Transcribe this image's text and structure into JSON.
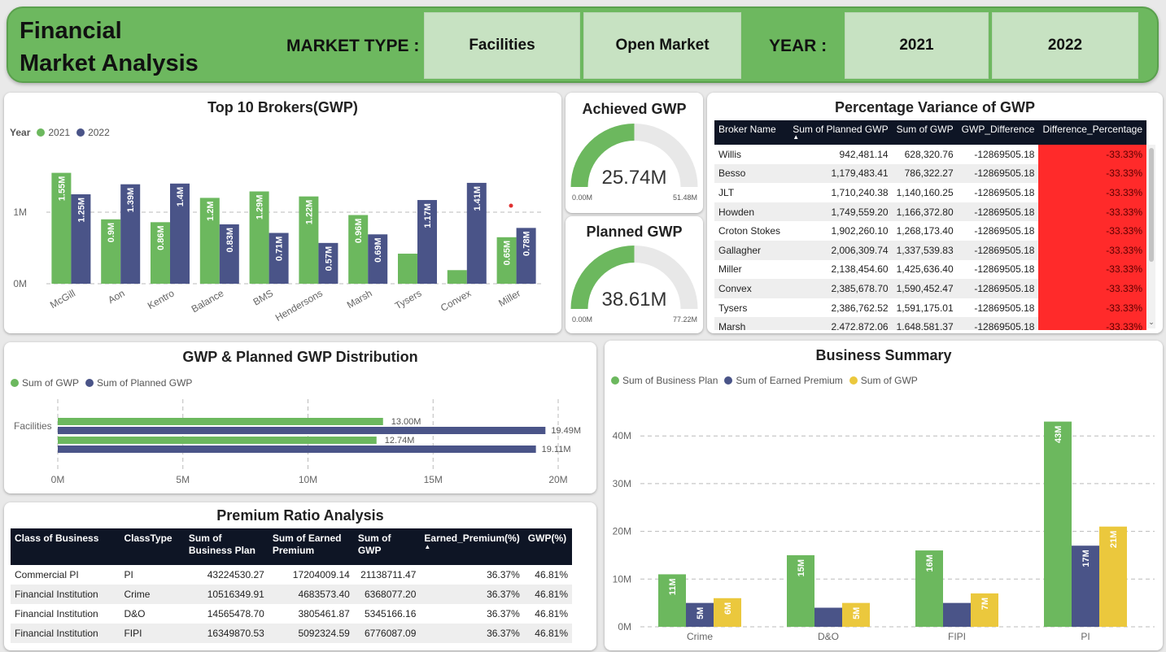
{
  "header": {
    "title_line1": "Financial",
    "title_line2": "Market Analysis",
    "market_type_label": "MARKET TYPE :",
    "market_types": [
      "Facilities",
      "Open Market"
    ],
    "year_label": "YEAR :",
    "years": [
      "2021",
      "2022"
    ]
  },
  "brokers_chart": {
    "title": "Top 10 Brokers(GWP)",
    "legend_title": "Year",
    "chart_data": {
      "type": "bar",
      "categories": [
        "McGill",
        "Aon",
        "Kentro",
        "Balance",
        "BMS",
        "Hendersons",
        "Marsh",
        "Tysers",
        "Convex",
        "Miller"
      ],
      "series": [
        {
          "name": "2021",
          "values": [
            1.55,
            0.9,
            0.86,
            1.2,
            1.29,
            1.22,
            0.96,
            0.42,
            0.19,
            0.65
          ],
          "labels": [
            "1.55M",
            "0.9M",
            "0.86M",
            "1.2M",
            "1.29M",
            "1.22M",
            "0.96M",
            "",
            "",
            "0.65M"
          ],
          "color": "#6cb85e"
        },
        {
          "name": "2022",
          "values": [
            1.25,
            1.39,
            1.4,
            0.83,
            0.71,
            0.57,
            0.69,
            1.17,
            1.41,
            0.78
          ],
          "labels": [
            "1.25M",
            "1.39M",
            "1.4M",
            "0.83M",
            "0.71M",
            "0.57M",
            "0.69M",
            "1.17M",
            "1.41M",
            "0.78M"
          ],
          "color": "#4a5488"
        }
      ],
      "y_ticks": [
        "0M",
        "1M"
      ],
      "y_tick_values": [
        0,
        1
      ],
      "ylim": [
        0,
        1.55
      ],
      "grid": true
    }
  },
  "achieved": {
    "title": "Achieved GWP",
    "value": "25.74M",
    "min": "0.00M",
    "max": "51.48M",
    "fraction": 0.5
  },
  "planned": {
    "title": "Planned GWP",
    "value": "38.61M",
    "min": "0.00M",
    "max": "77.22M",
    "fraction": 0.5
  },
  "variance": {
    "title": "Percentage Variance of GWP",
    "columns": [
      "Broker Name",
      "Sum of Planned GWP",
      "Sum of GWP",
      "GWP_Difference",
      "Difference_Percentage"
    ],
    "rows": [
      [
        "Willis",
        "942,481.14",
        "628,320.76",
        "-12869505.18",
        "-33.33%"
      ],
      [
        "Besso",
        "1,179,483.41",
        "786,322.27",
        "-12869505.18",
        "-33.33%"
      ],
      [
        "JLT",
        "1,710,240.38",
        "1,140,160.25",
        "-12869505.18",
        "-33.33%"
      ],
      [
        "Howden",
        "1,749,559.20",
        "1,166,372.80",
        "-12869505.18",
        "-33.33%"
      ],
      [
        "Croton Stokes",
        "1,902,260.10",
        "1,268,173.40",
        "-12869505.18",
        "-33.33%"
      ],
      [
        "Gallagher",
        "2,006,309.74",
        "1,337,539.83",
        "-12869505.18",
        "-33.33%"
      ],
      [
        "Miller",
        "2,138,454.60",
        "1,425,636.40",
        "-12869505.18",
        "-33.33%"
      ],
      [
        "Convex",
        "2,385,678.70",
        "1,590,452.47",
        "-12869505.18",
        "-33.33%"
      ],
      [
        "Tysers",
        "2,386,762.52",
        "1,591,175.01",
        "-12869505.18",
        "-33.33%"
      ],
      [
        "Marsh",
        "2,472,872.06",
        "1,648,581.37",
        "-12869505.18",
        "-33.33%"
      ]
    ]
  },
  "distribution": {
    "title": "GWP & Planned GWP Distribution",
    "legend": [
      "Sum of GWP",
      "Sum of Planned GWP"
    ],
    "chart_data": {
      "type": "bar",
      "orientation": "horizontal",
      "categories": [
        "Facilities",
        ""
      ],
      "series": [
        {
          "name": "Sum of GWP",
          "values": [
            13.0,
            12.74
          ],
          "labels": [
            "13.00M",
            "12.74M"
          ],
          "color": "#6cb85e"
        },
        {
          "name": "Sum of Planned GWP",
          "values": [
            19.49,
            19.11
          ],
          "labels": [
            "19.49M",
            "19.11M"
          ],
          "color": "#4a5488"
        }
      ],
      "x_ticks": [
        "0M",
        "5M",
        "10M",
        "15M",
        "20M"
      ],
      "x_tick_values": [
        0,
        5,
        10,
        15,
        20
      ],
      "xlim": [
        0,
        20
      ]
    }
  },
  "premium": {
    "title": "Premium Ratio Analysis",
    "columns": [
      "Class of Business",
      "ClassType",
      "Sum of Business Plan",
      "Sum of Earned Premium",
      "Sum of GWP",
      "Earned_Premium(%)",
      "GWP(%)"
    ],
    "rows": [
      [
        "Commercial PI",
        "PI",
        "43224530.27",
        "17204009.14",
        "21138711.47",
        "36.37%",
        "46.81%"
      ],
      [
        "Financial Institution",
        "Crime",
        "10516349.91",
        "4683573.40",
        "6368077.20",
        "36.37%",
        "46.81%"
      ],
      [
        "Financial Institution",
        "D&O",
        "14565478.70",
        "3805461.87",
        "5345166.16",
        "36.37%",
        "46.81%"
      ],
      [
        "Financial Institution",
        "FIPI",
        "16349870.53",
        "5092324.59",
        "6776087.09",
        "36.37%",
        "46.81%"
      ]
    ]
  },
  "summary": {
    "title": "Business Summary",
    "legend": [
      "Sum of Business Plan",
      "Sum of Earned Premium",
      "Sum of GWP"
    ],
    "chart_data": {
      "type": "bar",
      "categories": [
        "Crime",
        "D&O",
        "FIPI",
        "PI"
      ],
      "series": [
        {
          "name": "Sum of Business Plan",
          "values": [
            11,
            15,
            16,
            43
          ],
          "labels": [
            "11M",
            "15M",
            "16M",
            "43M"
          ],
          "color": "#6cb85e"
        },
        {
          "name": "Sum of Earned Premium",
          "values": [
            5,
            4,
            5,
            17
          ],
          "labels": [
            "5M",
            "",
            "",
            "17M"
          ],
          "color": "#4a5488"
        },
        {
          "name": "Sum of GWP",
          "values": [
            6,
            5,
            7,
            21
          ],
          "labels": [
            "6M",
            "5M",
            "7M",
            "21M"
          ],
          "color": "#ebc83d"
        }
      ],
      "y_ticks": [
        "0M",
        "10M",
        "20M",
        "30M",
        "40M"
      ],
      "y_tick_values": [
        0,
        10,
        20,
        30,
        40
      ],
      "ylim": [
        0,
        44
      ],
      "grid": true
    }
  },
  "colors": {
    "green": "#6cb85e",
    "navy": "#4a5488",
    "yellow": "#ebc83d",
    "red": "#ff2a2a",
    "header": "#6db85f",
    "slicer": "#c7e2c2"
  }
}
